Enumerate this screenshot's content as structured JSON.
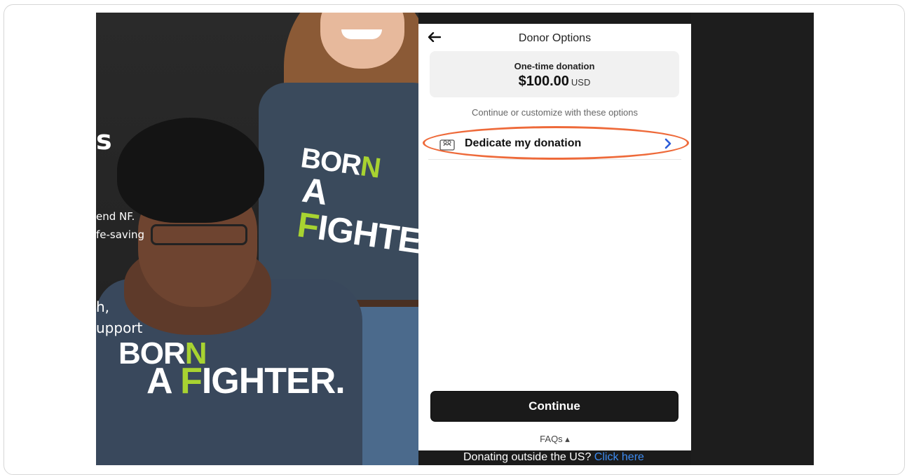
{
  "background": {
    "heading_fragment": "s",
    "line1": "end NF.",
    "line2": "fe-saving",
    "line3": "h,",
    "line4": "upport",
    "shirt_text": {
      "born": "BOR",
      "born_accent": "N",
      "fighter_prefix": "A ",
      "fighter_accent": "F",
      "fighter_rest": "IGHTER."
    },
    "outside_text": "Donating outside the US?",
    "outside_link": "Click here"
  },
  "modal": {
    "title": "Donor Options",
    "summary": {
      "label": "One-time donation",
      "amount": "$100.00",
      "currency": "USD"
    },
    "helper_text": "Continue or customize with these options",
    "options": [
      {
        "label": "Dedicate my donation",
        "icon": "gift-card-icon"
      }
    ],
    "continue_label": "Continue",
    "faqs_label": "FAQs ▴"
  },
  "colors": {
    "highlight": "#ee6a3a",
    "chevron": "#2b5cd9",
    "shirt_accent": "#a8d331",
    "link": "#3d8bf0"
  }
}
